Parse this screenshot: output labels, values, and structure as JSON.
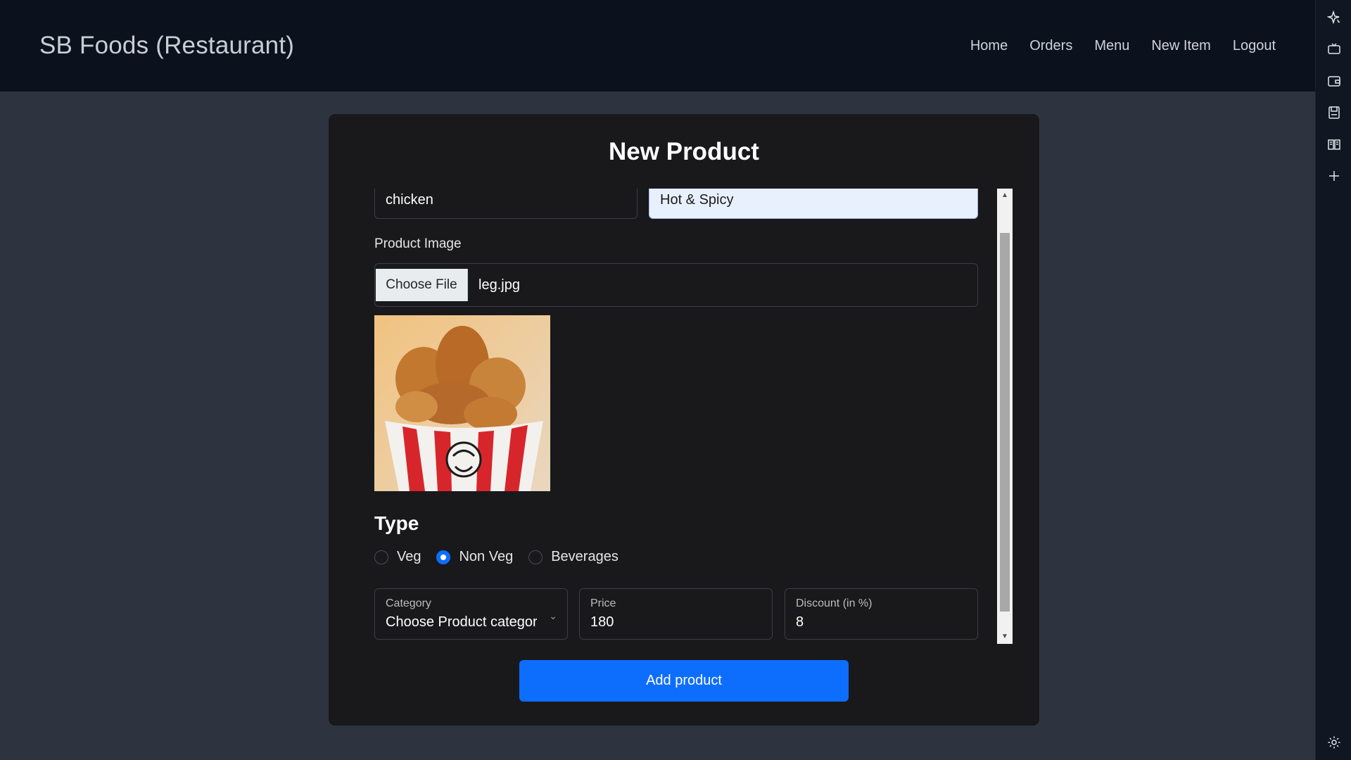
{
  "navbar": {
    "brand": "SB Foods (Restaurant)",
    "links": [
      "Home",
      "Orders",
      "Menu",
      "New Item",
      "Logout"
    ]
  },
  "side_rail": {
    "icons": [
      "sparkle-icon",
      "tv-icon",
      "wallet-icon",
      "save-icon",
      "book-icon",
      "plus-icon",
      "gear-icon"
    ]
  },
  "form": {
    "title": "New Product",
    "name_value": "chicken",
    "description_value": "Hot & Spicy",
    "image_label": "Product Image",
    "file_button": "Choose File",
    "file_name": "leg.jpg",
    "type_heading": "Type",
    "type_options": [
      "Veg",
      "Non Veg",
      "Beverages"
    ],
    "type_selected": "Non Veg",
    "category_label": "Category",
    "category_value": "Choose Product categor",
    "price_label": "Price",
    "price_value": "180",
    "discount_label": "Discount (in %)",
    "discount_value": "8",
    "submit_label": "Add product"
  },
  "colors": {
    "navbar_bg": "#0b111d",
    "page_bg": "#2d3440",
    "card_bg": "#19191b",
    "primary": "#0d6efd",
    "autofill_bg": "#e8f0fe"
  }
}
